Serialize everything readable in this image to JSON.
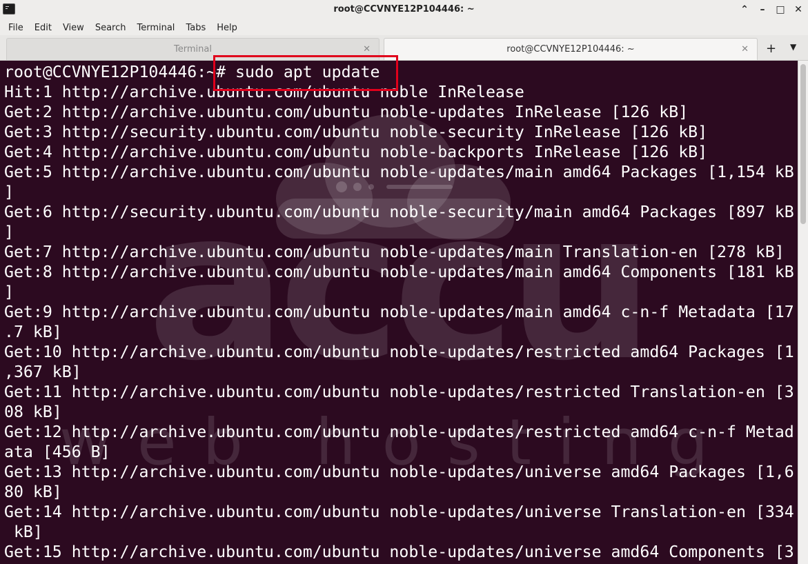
{
  "window": {
    "title": "root@CCVNYE12P104446: ~",
    "controls": {
      "collapse": "⌃",
      "minimize": "–",
      "maximize": "□",
      "close": "✕"
    }
  },
  "menu": {
    "items": [
      "File",
      "Edit",
      "View",
      "Search",
      "Terminal",
      "Tabs",
      "Help"
    ]
  },
  "tabs": [
    {
      "label": "Terminal",
      "close": "✕",
      "active": false
    },
    {
      "label": "root@CCVNYE12P104446: ~",
      "close": "✕",
      "active": true
    }
  ],
  "tabbar": {
    "add": "+",
    "menu": "▼"
  },
  "terminal": {
    "lines": [
      "root@CCVNYE12P104446:~# sudo apt update",
      "Hit:1 http://archive.ubuntu.com/ubuntu noble InRelease",
      "Get:2 http://archive.ubuntu.com/ubuntu noble-updates InRelease [126 kB]",
      "Get:3 http://security.ubuntu.com/ubuntu noble-security InRelease [126 kB]",
      "Get:4 http://archive.ubuntu.com/ubuntu noble-backports InRelease [126 kB]",
      "Get:5 http://archive.ubuntu.com/ubuntu noble-updates/main amd64 Packages [1,154 kB",
      "]",
      "Get:6 http://security.ubuntu.com/ubuntu noble-security/main amd64 Packages [897 kB",
      "]",
      "Get:7 http://archive.ubuntu.com/ubuntu noble-updates/main Translation-en [278 kB]",
      "Get:8 http://archive.ubuntu.com/ubuntu noble-updates/main amd64 Components [181 kB",
      "]",
      "Get:9 http://archive.ubuntu.com/ubuntu noble-updates/main amd64 c-n-f Metadata [17",
      ".7 kB]",
      "Get:10 http://archive.ubuntu.com/ubuntu noble-updates/restricted amd64 Packages [1",
      ",367 kB]",
      "Get:11 http://archive.ubuntu.com/ubuntu noble-updates/restricted Translation-en [3",
      "08 kB]",
      "Get:12 http://archive.ubuntu.com/ubuntu noble-updates/restricted amd64 c-n-f Metad",
      "ata [456 B]",
      "Get:13 http://archive.ubuntu.com/ubuntu noble-updates/universe amd64 Packages [1,6",
      "80 kB]",
      "Get:14 http://archive.ubuntu.com/ubuntu noble-updates/universe Translation-en [334",
      " kB]",
      "Get:15 http://archive.ubuntu.com/ubuntu noble-updates/universe amd64 Components [3"
    ]
  },
  "watermark": {
    "text_top": "accu",
    "text_bottom": "web hosting"
  },
  "colors": {
    "terminal_bg": "#2c0a20",
    "terminal_fg": "#ffffff",
    "highlight": "#e0001b",
    "chrome_bg": "#eeedeb"
  }
}
